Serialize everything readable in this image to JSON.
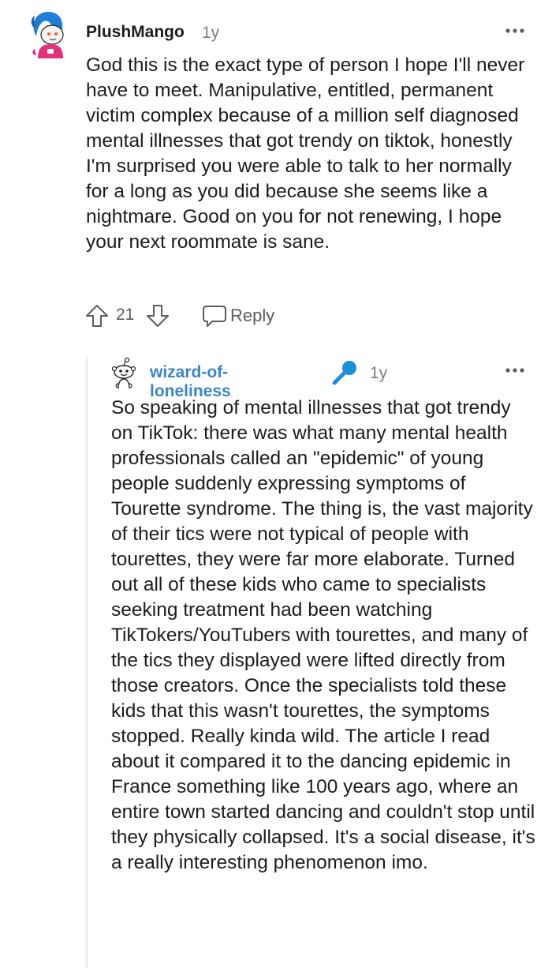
{
  "comments": [
    {
      "username": "PlushMango",
      "time": "1y",
      "body": "God this is the exact type of person I hope I'll never have to meet. Manipulative, entitled, permanent victim complex because of a million self diagnosed mental illnesses that got trendy on tiktok, honestly I'm surprised you were able to talk to her normally for a long as you did because she seems like a nightmare. Good on you for not renewing, I hope your next roommate is sane.",
      "score": "21",
      "reply_label": "Reply",
      "avatar_icon": "snoo-avatar-blue-hair-icon",
      "more_icon": "more-options-icon"
    },
    {
      "username": "wizard-of-loneliness",
      "time": "1y",
      "flair_icon": "microphone-icon",
      "body": "So speaking of mental illnesses that got trendy on TikTok: there was what many mental health professionals called an \"epidemic\" of young people suddenly expressing symptoms of Tourette syndrome. The thing is, the vast majority of their tics were not typical of people with tourettes, they were far more elaborate. Turned out all of these kids who came to specialists seeking treatment had been watching TikTokers/YouTubers with tourettes, and many of the tics they displayed were lifted directly from those creators. Once the specialists told these kids that this wasn't tourettes, the symptoms stopped. Really kinda wild. The article I read about it compared it to the dancing epidemic in France something like 100 years ago, where an entire town started dancing and couldn't stop until they physically collapsed. It's a social disease, it's a really interesting phenomenon imo.",
      "avatar_icon": "default-snoo-avatar-icon",
      "more_icon": "more-options-icon"
    }
  ],
  "colors": {
    "username_link": "#3b86c6",
    "text": "#1c1c1c",
    "muted": "#7c7c7c",
    "thread_line": "#e6e6e6",
    "flair_blue": "#1d8fd8"
  }
}
